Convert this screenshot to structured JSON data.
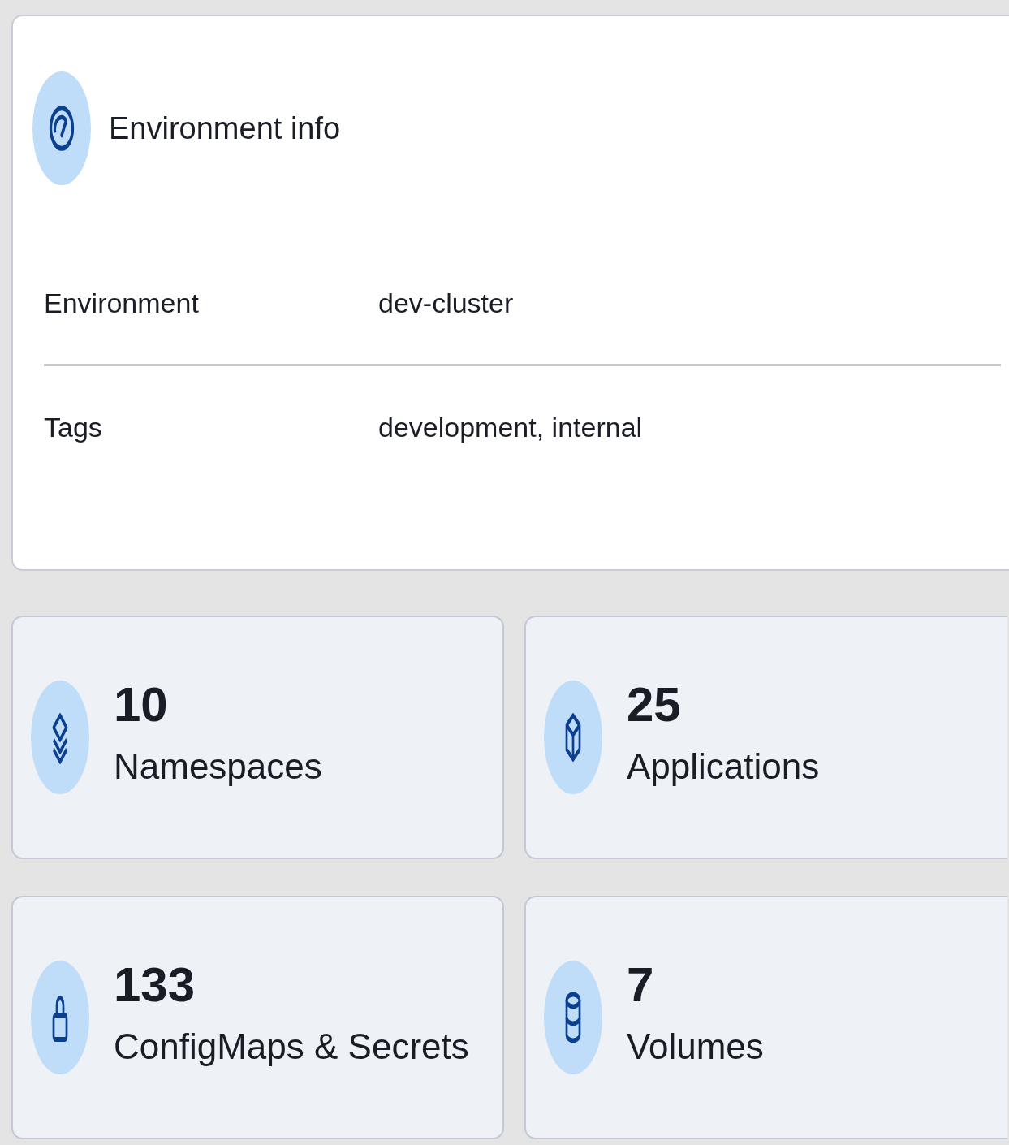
{
  "environment_info": {
    "title": "Environment info",
    "rows": [
      {
        "label": "Environment",
        "value": "dev-cluster"
      },
      {
        "label": "Tags",
        "value": "development, internal"
      }
    ]
  },
  "stats": [
    {
      "count": "10",
      "label": "Namespaces"
    },
    {
      "count": "25",
      "label": "Applications"
    },
    {
      "count": "133",
      "label": "ConfigMaps & Secrets"
    },
    {
      "count": "7",
      "label": "Volumes"
    }
  ]
}
